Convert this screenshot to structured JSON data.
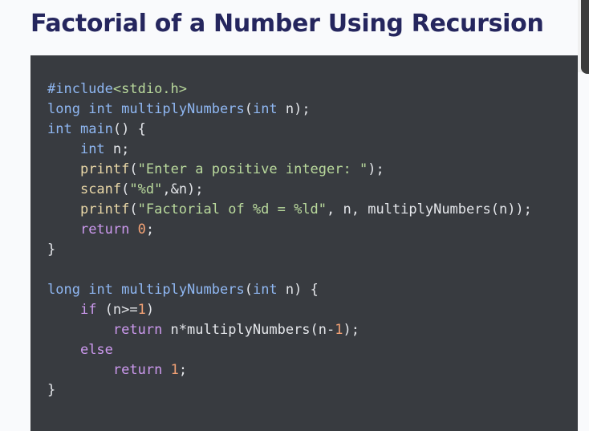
{
  "page": {
    "heading": "Factorial of a Number Using Recursion"
  },
  "code": {
    "lines": [
      [
        {
          "t": "#include",
          "c": "pp"
        },
        {
          "t": "<stdio.h>",
          "c": "hdr"
        }
      ],
      [
        {
          "t": "long",
          "c": "ty"
        },
        {
          "t": " "
        },
        {
          "t": "int",
          "c": "ty"
        },
        {
          "t": " "
        },
        {
          "t": "multiplyNumbers",
          "c": "ty"
        },
        {
          "t": "("
        },
        {
          "t": "int",
          "c": "ty"
        },
        {
          "t": " n);"
        }
      ],
      [
        {
          "t": "int",
          "c": "ty"
        },
        {
          "t": " "
        },
        {
          "t": "main",
          "c": "ty"
        },
        {
          "t": "() {"
        }
      ],
      [
        {
          "t": "    "
        },
        {
          "t": "int",
          "c": "ty"
        },
        {
          "t": " n;"
        }
      ],
      [
        {
          "t": "    "
        },
        {
          "t": "printf",
          "c": "fn"
        },
        {
          "t": "("
        },
        {
          "t": "\"Enter a positive integer: \"",
          "c": "str"
        },
        {
          "t": ");"
        }
      ],
      [
        {
          "t": "    "
        },
        {
          "t": "scanf",
          "c": "fn"
        },
        {
          "t": "("
        },
        {
          "t": "\"%d\"",
          "c": "str"
        },
        {
          "t": ",&n);"
        }
      ],
      [
        {
          "t": "    "
        },
        {
          "t": "printf",
          "c": "fn"
        },
        {
          "t": "("
        },
        {
          "t": "\"Factorial of %d = %ld\"",
          "c": "str"
        },
        {
          "t": ", n, multiplyNumbers(n));"
        }
      ],
      [
        {
          "t": "    "
        },
        {
          "t": "return",
          "c": "kw"
        },
        {
          "t": " "
        },
        {
          "t": "0",
          "c": "num"
        },
        {
          "t": ";"
        }
      ],
      [
        {
          "t": "}"
        }
      ],
      [],
      [
        {
          "t": "long",
          "c": "ty"
        },
        {
          "t": " "
        },
        {
          "t": "int",
          "c": "ty"
        },
        {
          "t": " "
        },
        {
          "t": "multiplyNumbers",
          "c": "ty"
        },
        {
          "t": "("
        },
        {
          "t": "int",
          "c": "ty"
        },
        {
          "t": " n) {"
        }
      ],
      [
        {
          "t": "    "
        },
        {
          "t": "if",
          "c": "kw"
        },
        {
          "t": " (n>="
        },
        {
          "t": "1",
          "c": "num"
        },
        {
          "t": ")"
        }
      ],
      [
        {
          "t": "        "
        },
        {
          "t": "return",
          "c": "kw"
        },
        {
          "t": " n*multiplyNumbers(n-"
        },
        {
          "t": "1",
          "c": "num"
        },
        {
          "t": ");"
        }
      ],
      [
        {
          "t": "    "
        },
        {
          "t": "else",
          "c": "kw"
        }
      ],
      [
        {
          "t": "        "
        },
        {
          "t": "return",
          "c": "kw"
        },
        {
          "t": " "
        },
        {
          "t": "1",
          "c": "num"
        },
        {
          "t": ";"
        }
      ],
      [
        {
          "t": "}"
        }
      ]
    ]
  },
  "colors": {
    "heading": "#25265e",
    "code_background": "#383b40",
    "code_text": "#e4e6ea",
    "keyword": "#cc99ee",
    "type": "#8fb7f2",
    "function": "#e9d7a7",
    "string": "#b9d99c",
    "number": "#f3a275"
  }
}
